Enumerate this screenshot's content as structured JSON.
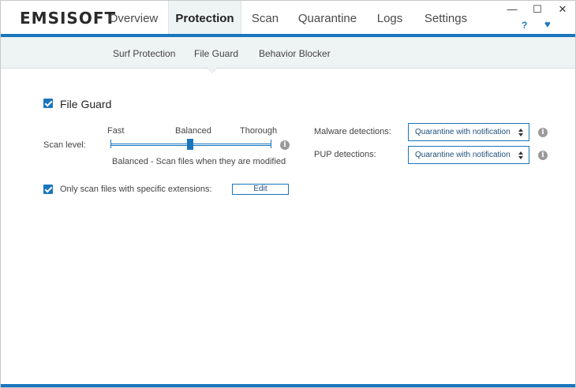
{
  "app": {
    "logo_text": "EMSISOFT"
  },
  "nav": {
    "tabs": [
      {
        "label": "Overview",
        "active": false
      },
      {
        "label": "Protection",
        "active": true
      },
      {
        "label": "Scan",
        "active": false
      },
      {
        "label": "Quarantine",
        "active": false
      },
      {
        "label": "Logs",
        "active": false
      },
      {
        "label": "Settings",
        "active": false
      }
    ]
  },
  "window_controls": {
    "minimize_glyph": "—",
    "maximize_glyph": "☐",
    "close_glyph": "✕"
  },
  "header_icons": {
    "help_glyph": "?",
    "heart_glyph": "♥"
  },
  "subnav": {
    "tabs": [
      {
        "label": "Surf Protection",
        "active": false
      },
      {
        "label": "File Guard",
        "active": true
      },
      {
        "label": "Behavior Blocker",
        "active": false
      }
    ]
  },
  "file_guard": {
    "enabled": true,
    "label": "File Guard",
    "scan_level": {
      "label": "Scan level:",
      "ticks": [
        "Fast",
        "Balanced",
        "Thorough"
      ],
      "selected_index": 1,
      "selected_fraction": 0.5,
      "description": "Balanced - Scan files when they are modified"
    },
    "malware_detections": {
      "label": "Malware detections:",
      "value": "Quarantine with notification"
    },
    "pup_detections": {
      "label": "PUP detections:",
      "value": "Quarantine with notification"
    },
    "extensions": {
      "checked": true,
      "label": "Only scan files with specific extensions:",
      "edit_label": "Edit"
    },
    "info_glyph": "i"
  },
  "colors": {
    "accent": "#1976bd",
    "subnav_bg": "#eef3f4",
    "info_gray": "#9a9a9a"
  }
}
